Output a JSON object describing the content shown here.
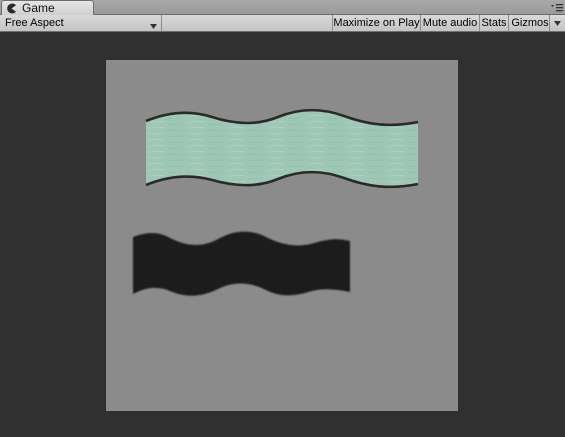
{
  "tab": {
    "title": "Game",
    "icon": "pacman-icon",
    "menu_icon": "tab-menu-icon"
  },
  "toolbar": {
    "aspect_dropdown": "Free Aspect",
    "maximize_label": "Maximize on Play",
    "mute_label": "Mute audio",
    "stats_label": "Stats",
    "gizmos_label": "Gizmos"
  },
  "colors": {
    "background": "#303030",
    "canvas": "#8b8b8b",
    "wave_fill": "#9ec7b5",
    "wave_outline": "#2a2a2a",
    "dark_wave": "#1e1e1e"
  }
}
